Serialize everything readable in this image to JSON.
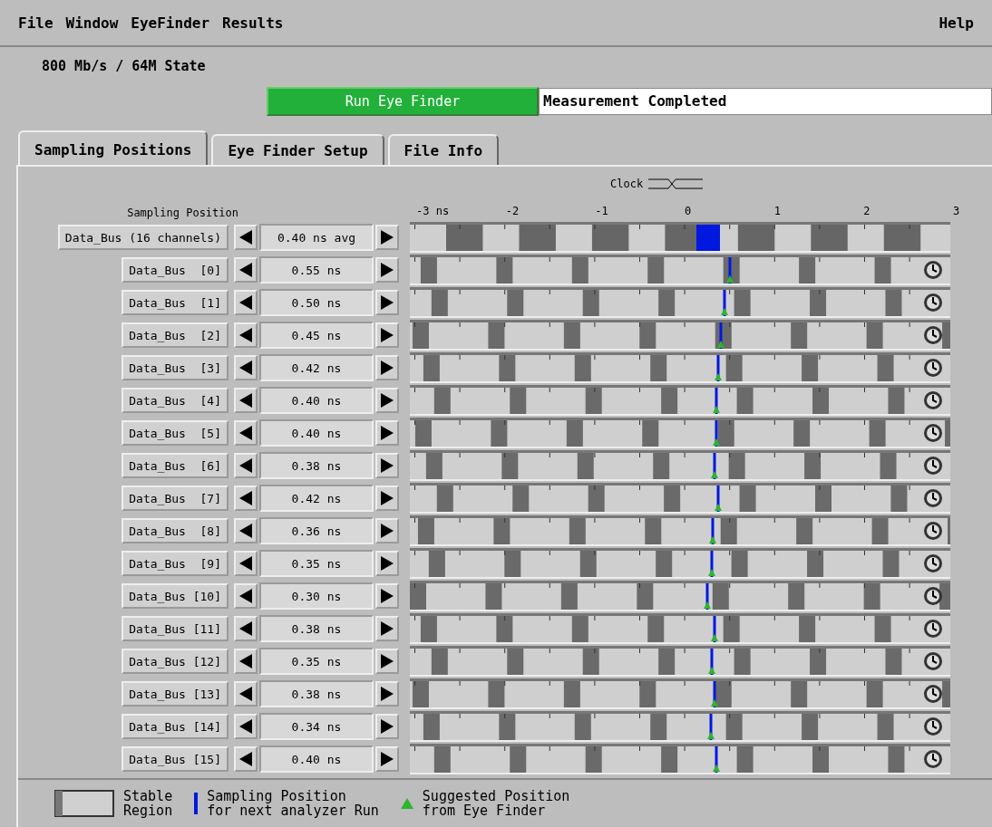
{
  "menu": {
    "items": [
      "File",
      "Window",
      "EyeFinder",
      "Results"
    ],
    "help": "Help"
  },
  "header": {
    "mode": "800 Mb/s /  64M State"
  },
  "run_button": {
    "label": "Run Eye Finder"
  },
  "status_field": {
    "value": "Measurement Completed"
  },
  "tabs": [
    {
      "label": "Sampling Positions",
      "selected": true
    },
    {
      "label": "Eye Finder Setup",
      "selected": false
    },
    {
      "label": "File Info",
      "selected": false
    }
  ],
  "axis": {
    "clock_label": "Clock",
    "title": "Sampling Position",
    "ticks": [
      "-3 ns",
      "-2",
      "-1",
      "0",
      "1",
      "2",
      "3"
    ]
  },
  "rows": [
    {
      "kind": "bus",
      "name": "Data_Bus (16 channels)",
      "value": "0.40 ns avg",
      "level": 0.567
    },
    {
      "kind": "channel",
      "name": "Data_Bus  [0]",
      "value": "0.55 ns",
      "level": 0.592
    },
    {
      "kind": "channel",
      "name": "Data_Bus  [1]",
      "value": "0.50 ns",
      "level": 0.583
    },
    {
      "kind": "channel",
      "name": "Data_Bus  [2]",
      "value": "0.45 ns",
      "level": 0.575
    },
    {
      "kind": "channel",
      "name": "Data_Bus  [3]",
      "value": "0.42 ns",
      "level": 0.57
    },
    {
      "kind": "channel",
      "name": "Data_Bus  [4]",
      "value": "0.40 ns",
      "level": 0.567
    },
    {
      "kind": "channel",
      "name": "Data_Bus  [5]",
      "value": "0.40 ns",
      "level": 0.567
    },
    {
      "kind": "channel",
      "name": "Data_Bus  [6]",
      "value": "0.38 ns",
      "level": 0.563
    },
    {
      "kind": "channel",
      "name": "Data_Bus  [7]",
      "value": "0.42 ns",
      "level": 0.57
    },
    {
      "kind": "channel",
      "name": "Data_Bus  [8]",
      "value": "0.36 ns",
      "level": 0.56
    },
    {
      "kind": "channel",
      "name": "Data_Bus  [9]",
      "value": "0.35 ns",
      "level": 0.558
    },
    {
      "kind": "channel",
      "name": "Data_Bus [10]",
      "value": "0.30 ns",
      "level": 0.55
    },
    {
      "kind": "channel",
      "name": "Data_Bus [11]",
      "value": "0.38 ns",
      "level": 0.563
    },
    {
      "kind": "channel",
      "name": "Data_Bus [12]",
      "value": "0.35 ns",
      "level": 0.558
    },
    {
      "kind": "channel",
      "name": "Data_Bus [13]",
      "value": "0.38 ns",
      "level": 0.563
    },
    {
      "kind": "channel",
      "name": "Data_Bus [14]",
      "value": "0.34 ns",
      "level": 0.557
    },
    {
      "kind": "channel",
      "name": "Data_Bus [15]",
      "value": "0.40 ns",
      "level": 0.567
    }
  ],
  "legend": [
    {
      "kind": "stable",
      "label": "Stable\nRegion"
    },
    {
      "kind": "sampling",
      "label": "Sampling Position\nfor next analyzer Run"
    },
    {
      "kind": "suggested",
      "label": "Suggested Position\nfrom Eye Finder"
    }
  ]
}
